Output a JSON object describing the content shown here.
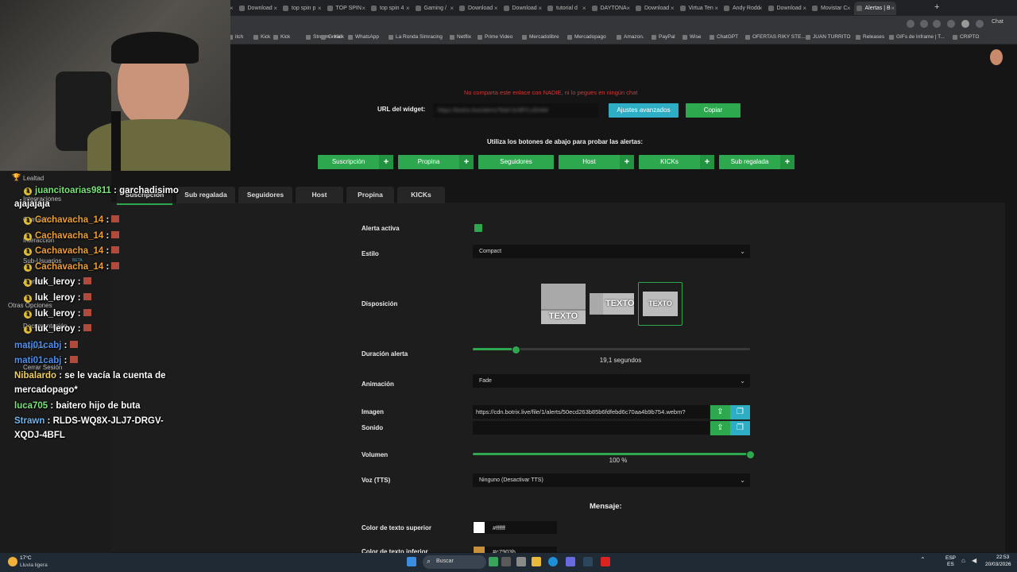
{
  "browser": {
    "tabs": [
      "Kick",
      "top spin j",
      "VIRTUA TE",
      "RPCS3 - U",
      "top spin 2",
      "Download",
      "top spin p",
      "TOP SPIN",
      "top spin 4",
      "Gaming /",
      "Download",
      "Download",
      "tutorial d",
      "DAYTONA",
      "Download",
      "Virtua Ten",
      "Andy Rodd",
      "Download",
      "Movistar C",
      "Alertas | B"
    ],
    "new_tab": "+",
    "bookmarks": [
      "itch",
      "Kick",
      "Kick",
      "Stream - Kick",
      "Gmail",
      "WhatsApp",
      "La Ronda Simracing",
      "Netflix",
      "Prime Video",
      "Mercadolibre",
      "Mercadopago",
      "Amazon.",
      "PayPal",
      "Wise",
      "ChatGPT",
      "OFERTAS RIKY STE...",
      "JUAN TURRITO",
      "Releases",
      "GIFs de Inframe | T...",
      "CRIPTO"
    ],
    "chat_label": "Chat"
  },
  "widget": {
    "warning": "No comparta este enlace con NADIE, ni lo pegues en ningún chat",
    "url_label": "URL del widget:",
    "url_value": "https://botrix.live/alerts?bid=3r4lPCu5h4M",
    "advanced_button": "Ajustes avanzados",
    "copy_button": "Copiar",
    "test_instructions": "Utiliza los botones de abajo para probar las alertas:",
    "test_buttons": [
      "Suscripción",
      "Propina",
      "Seguidores",
      "Host",
      "KICKs",
      "Sub regalada"
    ]
  },
  "settings_tabs": [
    "Suscripción",
    "Sub regalada",
    "Seguidores",
    "Host",
    "Propina",
    "KICKs"
  ],
  "form": {
    "active_label": "Alerta activa",
    "style_label": "Estilo",
    "style_value": "Compact",
    "layout_label": "Disposición",
    "layout_text": "TEXTO",
    "duration_label": "Duración alerta",
    "duration_value": 19.1,
    "duration_max": 60,
    "duration_text": "19,1 segundos",
    "animation_label": "Animación",
    "animation_value": "Fade",
    "image_label": "Imagen",
    "image_value": "https://cdn.botrix.live/file/1/alerts/50ecd263b85b6fdfebd6c70aa4b9b754.webm?",
    "sound_label": "Sonido",
    "volume_label": "Volumen",
    "volume_value": 100,
    "volume_text": "100 %",
    "tts_label": "Voz (TTS)",
    "tts_value": "Ninguno (Desactivar TTS)",
    "message_header": "Mensaje:",
    "top_color_label": "Color de texto superior",
    "top_color_value": "#ffffff",
    "bottom_color_label": "Color de texto inferior",
    "bottom_color_value": "#c7903b"
  },
  "sidebar_items": [
    "Lealtad",
    "Integraciones",
    "Comandos",
    "Interacción",
    "Sub-Usuarios",
    "Alertas",
    "Otras Opciones",
    "Documentación",
    "Soporte",
    "Cerrar Sesión"
  ],
  "sidebar_beta": "BETA",
  "chat_messages": [
    {
      "user": "juancitoarias9811",
      "text": ": garchadisimo",
      "color": "#7be37b",
      "badge": "1"
    },
    {
      "user": "",
      "text": "ajajajaja",
      "color": "#fff",
      "badge": ""
    },
    {
      "user": "Cachavacha_14",
      "text": ":",
      "color": "#f0a030",
      "badge": "1",
      "emote": true
    },
    {
      "user": "Cachavacha_14",
      "text": ":",
      "color": "#f0a030",
      "badge": "1",
      "emote": true
    },
    {
      "user": "Cachavacha_14",
      "text": ":",
      "color": "#f0a030",
      "badge": "1",
      "emote": true
    },
    {
      "user": "Cachavacha_14",
      "text": ":",
      "color": "#f0a030",
      "badge": "1",
      "emote": true
    },
    {
      "user": "luk_leroy",
      "text": ":",
      "color": "#fff",
      "badge": "1",
      "emote": true
    },
    {
      "user": "luk_leroy",
      "text": ":",
      "color": "#fff",
      "badge": "1",
      "emote": true
    },
    {
      "user": "luk_leroy",
      "text": ":",
      "color": "#fff",
      "badge": "1",
      "emote": true
    },
    {
      "user": "luk_leroy",
      "text": ":",
      "color": "#fff",
      "badge": "1",
      "emote": true
    },
    {
      "user": "mati01cabj",
      "text": ":",
      "color": "#4d8ff0",
      "badge": "",
      "emote": true
    },
    {
      "user": "mati01cabj",
      "text": ":",
      "color": "#4d8ff0",
      "badge": "",
      "emote": true
    },
    {
      "user": "Nibalardo",
      "text": ": se le vacía la cuenta de",
      "color": "#f0d060",
      "badge": ""
    },
    {
      "user": "",
      "text": "mercadopago*",
      "color": "#fff",
      "badge": ""
    },
    {
      "user": "luca705",
      "text": ": baitero hijo de buta",
      "color": "#7be37b",
      "badge": ""
    },
    {
      "user": "Strawn",
      "text": ": RLDS-WQ8X-JLJ7-DRGV-",
      "color": "#6fb6f0",
      "badge": ""
    },
    {
      "user": "",
      "text": "XQDJ-4BFL",
      "color": "#fff",
      "badge": ""
    }
  ],
  "taskbar": {
    "weather_temp": "17°C",
    "weather_text": "Lluvia ligera",
    "search_label": "Buscar",
    "lang_top": "ESP",
    "lang_bottom": "ES",
    "time": "22:53",
    "date": "20/03/2026"
  },
  "colors": {
    "accent": "#2ea84e",
    "teal": "#2eaec4",
    "warning": "#c93b3b"
  }
}
